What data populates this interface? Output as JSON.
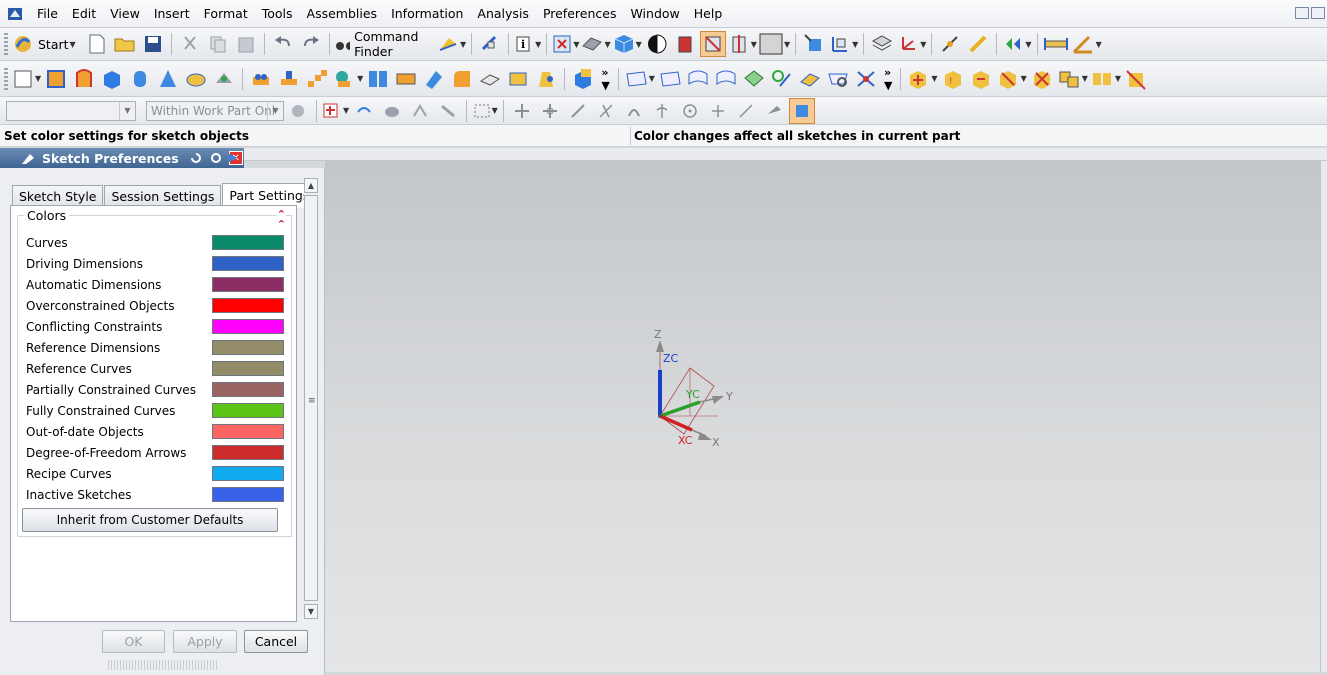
{
  "menubar": {
    "items": [
      "File",
      "Edit",
      "View",
      "Insert",
      "Format",
      "Tools",
      "Assemblies",
      "Information",
      "Analysis",
      "Preferences",
      "Window",
      "Help"
    ]
  },
  "toolbar_standard": {
    "start_label": "Start",
    "command_finder_label": "Command Finder"
  },
  "selection_bar": {
    "type_filter_value": "",
    "scope_value": "Within Work Part Onl"
  },
  "cue_line": {
    "cue": "Set color settings for sketch objects",
    "status": "Color changes affect all sketches in current part"
  },
  "dialog": {
    "title": "Sketch Preferences",
    "tabs": [
      {
        "label": "Sketch Style",
        "active": false
      },
      {
        "label": "Session Settings",
        "active": false
      },
      {
        "label": "Part Settings",
        "active": true
      }
    ],
    "group_title": "Colors",
    "colors": [
      {
        "label": "Curves",
        "color": "#0b8a69"
      },
      {
        "label": "Driving Dimensions",
        "color": "#2f62c7"
      },
      {
        "label": "Automatic Dimensions",
        "color": "#8c2e63"
      },
      {
        "label": "Overconstrained Objects",
        "color": "#ff0000"
      },
      {
        "label": "Conflicting Constraints",
        "color": "#ff00ff"
      },
      {
        "label": "Reference Dimensions",
        "color": "#938c68"
      },
      {
        "label": "Reference Curves",
        "color": "#938c68"
      },
      {
        "label": "Partially Constrained Curves",
        "color": "#9a6363"
      },
      {
        "label": "Fully Constrained Curves",
        "color": "#5ac514"
      },
      {
        "label": "Out-of-date Objects",
        "color": "#ff6464"
      },
      {
        "label": "Degree-of-Freedom Arrows",
        "color": "#cc2b2b"
      },
      {
        "label": "Recipe Curves",
        "color": "#10aaee"
      },
      {
        "label": "Inactive Sketches",
        "color": "#3a62e8"
      }
    ],
    "inherit_button": "Inherit from Customer Defaults",
    "ok_label": "OK",
    "apply_label": "Apply",
    "cancel_label": "Cancel"
  },
  "triad": {
    "z_label": "Z",
    "zc_label": "ZC",
    "y_label": "Y",
    "yc_label": "YC",
    "x_label": "X",
    "xc_label": "XC"
  }
}
